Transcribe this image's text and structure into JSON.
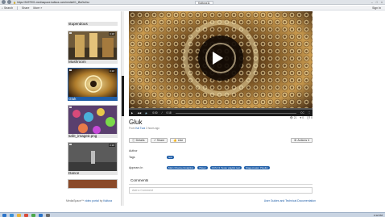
{
  "browser": {
    "address": "https://5497901.mediaspace.kaltura.com/media/t/1_l8w0w0xz",
    "tab_title": "Kaltura11",
    "toolbar_items": [
      "Search",
      "Share",
      "More"
    ],
    "sign_in": "Sign In"
  },
  "sidebar": {
    "items": [
      {
        "label": "stupendous",
        "active": false
      },
      {
        "label": "Mushroom",
        "active": false
      },
      {
        "label": "Gluk",
        "active": true
      },
      {
        "label": "safe_image2.png",
        "active": false
      },
      {
        "label": "Dance",
        "active": false
      }
    ],
    "thumb_meta": "0:18"
  },
  "player": {
    "time_current": "0:00",
    "time_total": "0:18",
    "progress": 0.0
  },
  "media": {
    "title": "Gluk",
    "byline_prefix": "From",
    "author": "Kal Tura",
    "byline_suffix": "3 hours ago",
    "stats": [
      "21",
      "0",
      "0"
    ]
  },
  "actions": {
    "details": "Details",
    "share": "Share",
    "like": "Like",
    "actions": "Actions"
  },
  "details": {
    "author_label": "Author",
    "tags_label": "Tags",
    "tags": [
      "test"
    ],
    "appears_label": "Appears In",
    "channels": [
      "Main Channel Analytics",
      "Player",
      "CCS F1 Tester playlist test",
      "Stagecreator Playlist"
    ]
  },
  "comments": {
    "header": "Comments",
    "placeholder": "Add a Comment"
  },
  "footer": {
    "left_prefix": "MediaSpace™",
    "left_link": "video portal",
    "left_by": "by",
    "left_brand": "Kaltura",
    "right": "User Guides and Technical Documentation"
  },
  "taskbar": {
    "clock": "4:12 PM"
  }
}
